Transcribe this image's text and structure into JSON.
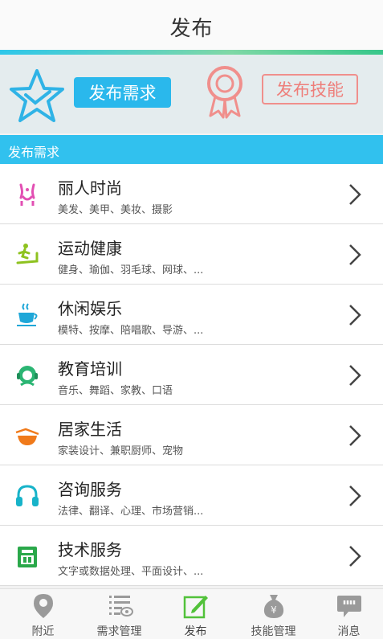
{
  "header": {
    "title": "发布"
  },
  "banner": {
    "post_demand_label": "发布需求",
    "post_skill_label": "发布技能"
  },
  "section": {
    "title": "发布需求"
  },
  "categories": [
    {
      "name": "丽人时尚",
      "sub": "美发、美甲、美妆、摄影",
      "icon": "body-shape-icon",
      "color": "#e24fb3"
    },
    {
      "name": "运动健康",
      "sub": "健身、瑜伽、羽毛球、网球、...",
      "icon": "treadmill-icon",
      "color": "#8ec21f"
    },
    {
      "name": "休闲娱乐",
      "sub": "模特、按摩、陪唱歌、导游、...",
      "icon": "coffee-cup-icon",
      "color": "#1fa7d8"
    },
    {
      "name": "教育培训",
      "sub": "音乐、舞蹈、家教、口语",
      "icon": "headset-person-icon",
      "color": "#2bb573"
    },
    {
      "name": "居家生活",
      "sub": "家装设计、兼职厨师、宠物",
      "icon": "cooking-pot-icon",
      "color": "#f07a1a"
    },
    {
      "name": "咨询服务",
      "sub": "法律、翻译、心理、市场营销...",
      "icon": "headphones-icon",
      "color": "#17b3c9"
    },
    {
      "name": "技术服务",
      "sub": "文字或数据处理、平面设计、...",
      "icon": "toolbox-icon",
      "color": "#2aa84a"
    }
  ],
  "tabs": [
    {
      "label": "附近",
      "icon": "location-pin-icon"
    },
    {
      "label": "需求管理",
      "icon": "list-eye-icon"
    },
    {
      "label": "发布",
      "icon": "edit-pen-icon",
      "active": true,
      "accent": "#52c23a"
    },
    {
      "label": "技能管理",
      "icon": "money-bag-icon"
    },
    {
      "label": "消息",
      "icon": "chat-bubble-icon"
    }
  ]
}
